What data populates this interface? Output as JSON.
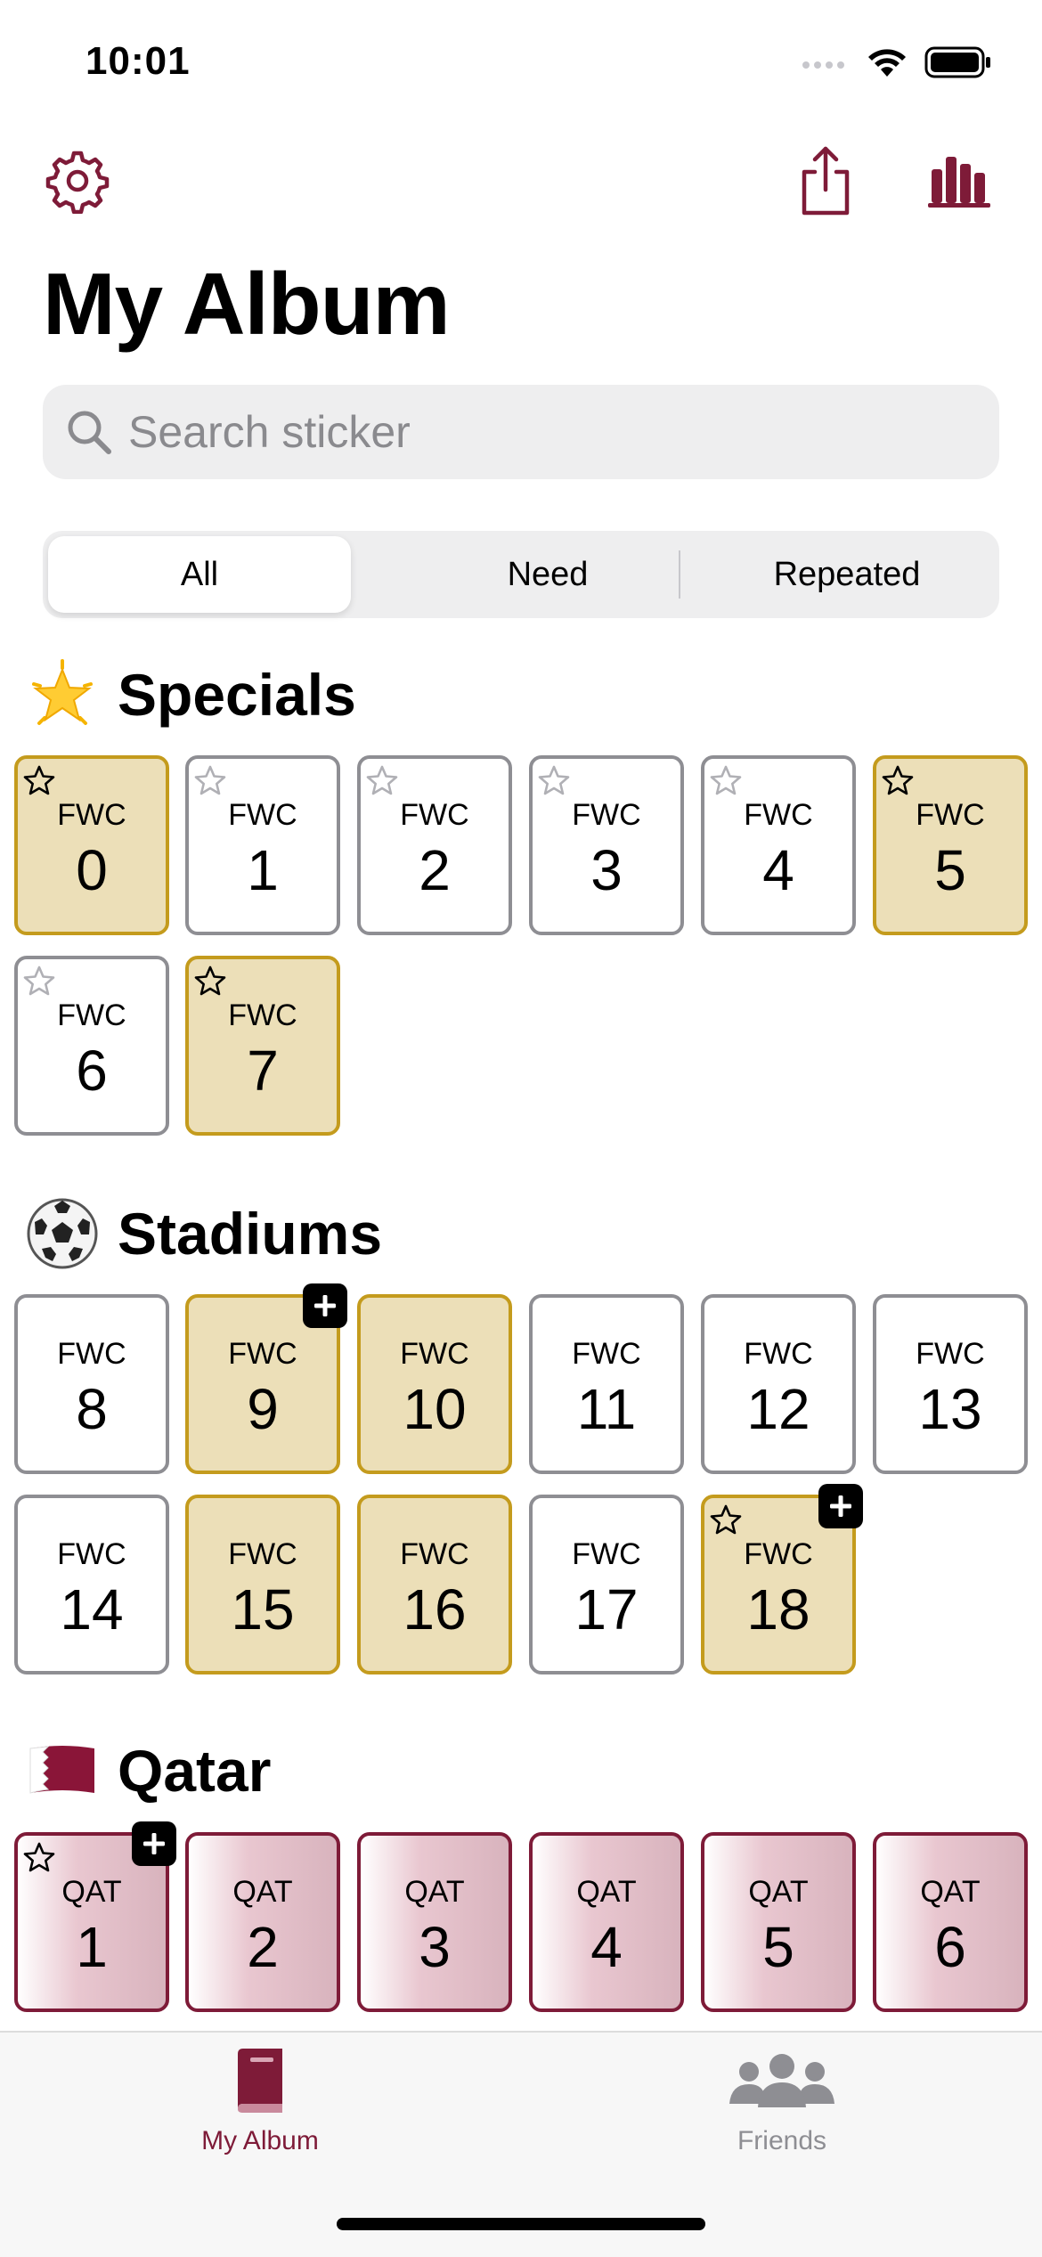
{
  "status_bar": {
    "time": "10:01"
  },
  "toolbar": {
    "settings": "settings",
    "share": "share",
    "stats": "stats"
  },
  "title": "My Album",
  "search": {
    "placeholder": "Search sticker"
  },
  "segments": [
    "All",
    "Need",
    "Repeated"
  ],
  "segment_selected": "All",
  "colors": {
    "accent": "#7e1b38",
    "owned_fill": "#ecdfb8",
    "owned_border": "#c49b1d",
    "missing_border": "#8e8e93"
  },
  "sections": [
    {
      "title": "Specials",
      "icon": "glowing-star-emoji",
      "stickers": [
        {
          "code": "FWC",
          "num": "0",
          "owned": true,
          "star": "filled"
        },
        {
          "code": "FWC",
          "num": "1",
          "owned": false,
          "star": "outline"
        },
        {
          "code": "FWC",
          "num": "2",
          "owned": false,
          "star": "outline"
        },
        {
          "code": "FWC",
          "num": "3",
          "owned": false,
          "star": "outline"
        },
        {
          "code": "FWC",
          "num": "4",
          "owned": false,
          "star": "outline"
        },
        {
          "code": "FWC",
          "num": "5",
          "owned": true,
          "star": "filled"
        },
        {
          "code": "FWC",
          "num": "6",
          "owned": false,
          "star": "outline"
        },
        {
          "code": "FWC",
          "num": "7",
          "owned": true,
          "star": "filled"
        }
      ]
    },
    {
      "title": "Stadiums",
      "icon": "soccer-ball-emoji",
      "stickers": [
        {
          "code": "FWC",
          "num": "8",
          "owned": false
        },
        {
          "code": "FWC",
          "num": "9",
          "owned": true,
          "repeated": true
        },
        {
          "code": "FWC",
          "num": "10",
          "owned": true
        },
        {
          "code": "FWC",
          "num": "11",
          "owned": false
        },
        {
          "code": "FWC",
          "num": "12",
          "owned": false
        },
        {
          "code": "FWC",
          "num": "13",
          "owned": false
        },
        {
          "code": "FWC",
          "num": "14",
          "owned": false
        },
        {
          "code": "FWC",
          "num": "15",
          "owned": true
        },
        {
          "code": "FWC",
          "num": "16",
          "owned": true
        },
        {
          "code": "FWC",
          "num": "17",
          "owned": false
        },
        {
          "code": "FWC",
          "num": "18",
          "owned": true,
          "star": "filled",
          "repeated": true
        }
      ]
    },
    {
      "title": "Qatar",
      "icon": "qatar-flag-emoji",
      "stickers": [
        {
          "code": "QAT",
          "num": "1",
          "owned": true,
          "star": "filled",
          "repeated": true
        },
        {
          "code": "QAT",
          "num": "2",
          "owned": true
        },
        {
          "code": "QAT",
          "num": "3",
          "owned": true
        },
        {
          "code": "QAT",
          "num": "4",
          "owned": true
        },
        {
          "code": "QAT",
          "num": "5",
          "owned": true
        },
        {
          "code": "QAT",
          "num": "6",
          "owned": true
        }
      ]
    }
  ],
  "tabs": [
    {
      "label": "My Album",
      "icon": "album-book-icon",
      "active": true
    },
    {
      "label": "Friends",
      "icon": "people-group-icon",
      "active": false
    }
  ]
}
